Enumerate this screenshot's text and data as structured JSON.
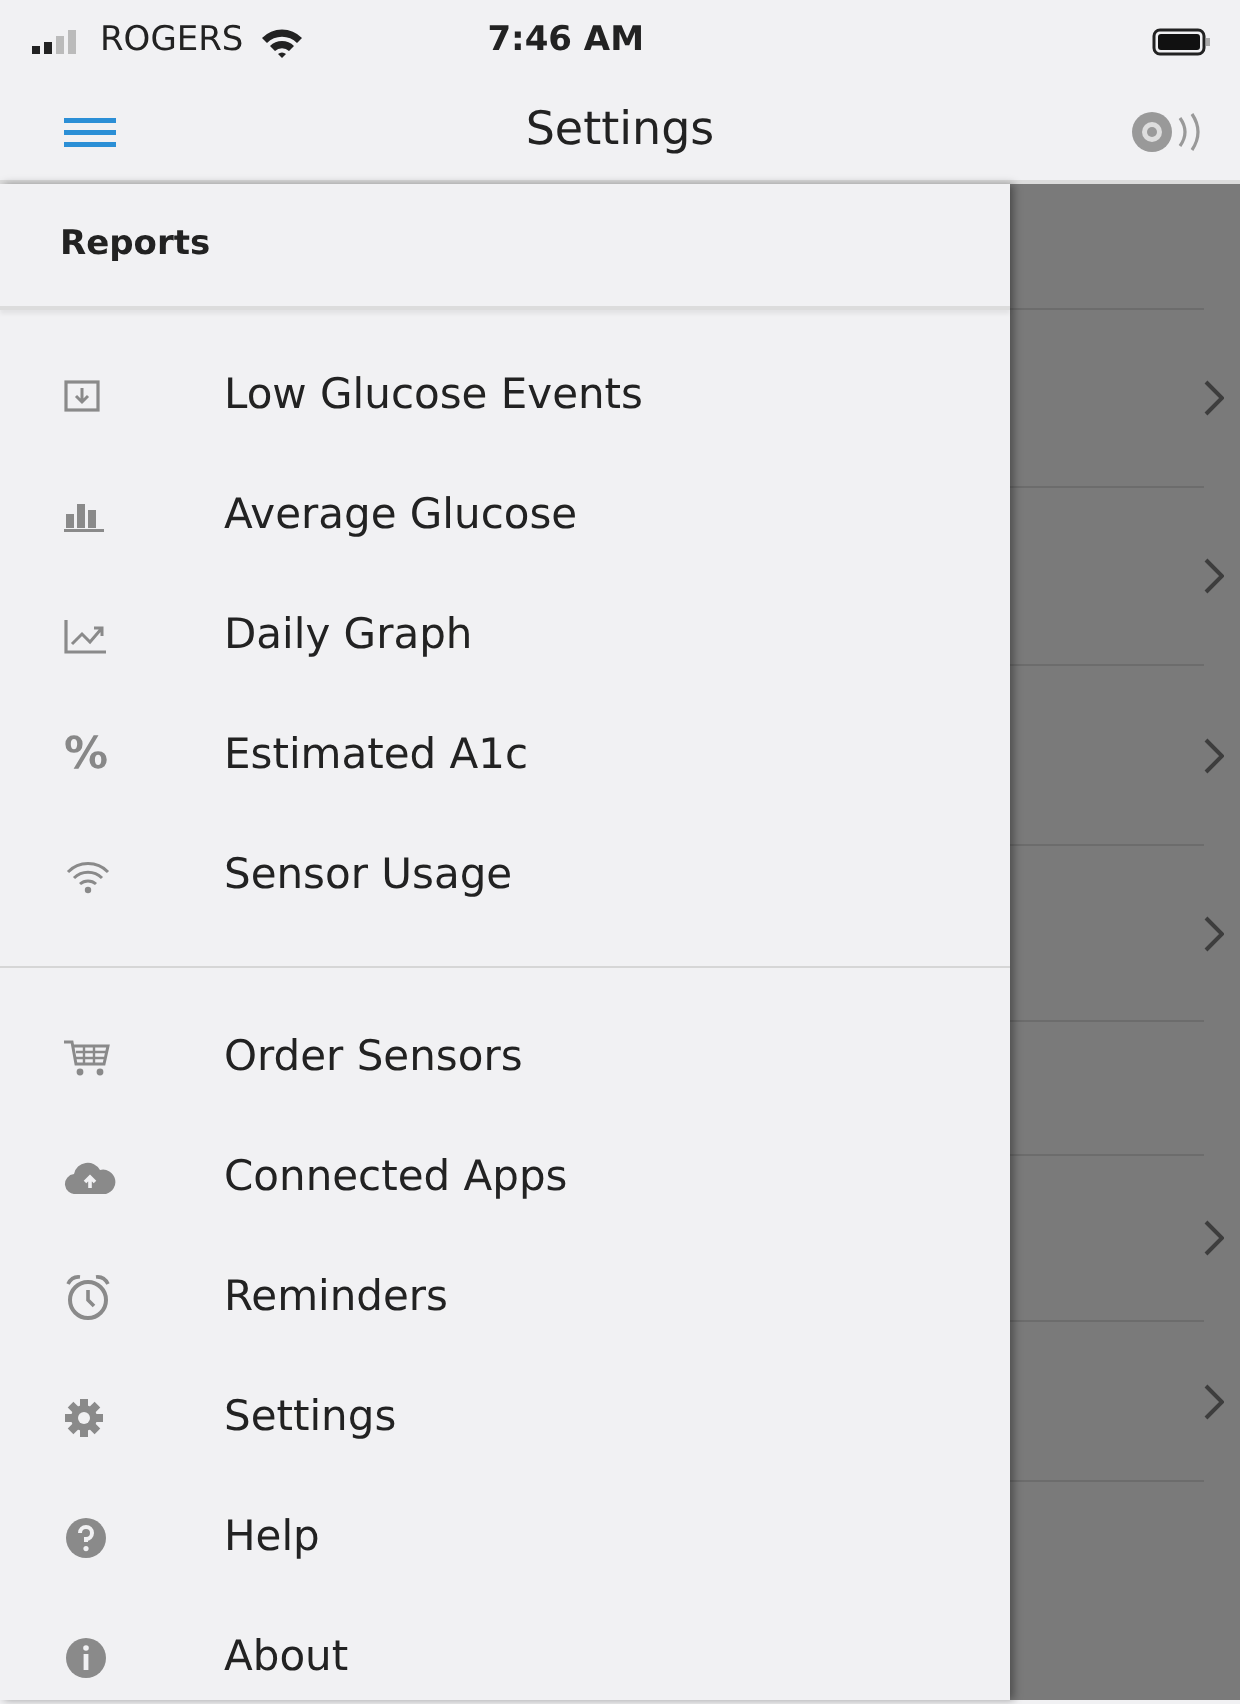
{
  "status_bar": {
    "carrier": "ROGERS",
    "time": "7:46 AM"
  },
  "nav_bar": {
    "title": "Settings"
  },
  "drawer": {
    "header": "Reports",
    "sections": [
      {
        "items": [
          {
            "label": "Low Glucose Events"
          },
          {
            "label": "Average Glucose"
          },
          {
            "label": "Daily Graph"
          },
          {
            "label": "Estimated A1c",
            "icon_text": "%"
          },
          {
            "label": "Sensor Usage"
          }
        ]
      },
      {
        "items": [
          {
            "label": "Order Sensors"
          },
          {
            "label": "Connected Apps"
          },
          {
            "label": "Reminders"
          },
          {
            "label": "Settings"
          },
          {
            "label": "Help"
          },
          {
            "label": "About"
          }
        ]
      }
    ]
  },
  "background_rows": [
    {
      "chevron": false
    },
    {
      "chevron": true
    },
    {
      "chevron": true
    },
    {
      "chevron": true
    },
    {
      "chevron": true
    },
    {
      "chevron": false
    },
    {
      "chevron": true
    },
    {
      "chevron": true
    }
  ]
}
